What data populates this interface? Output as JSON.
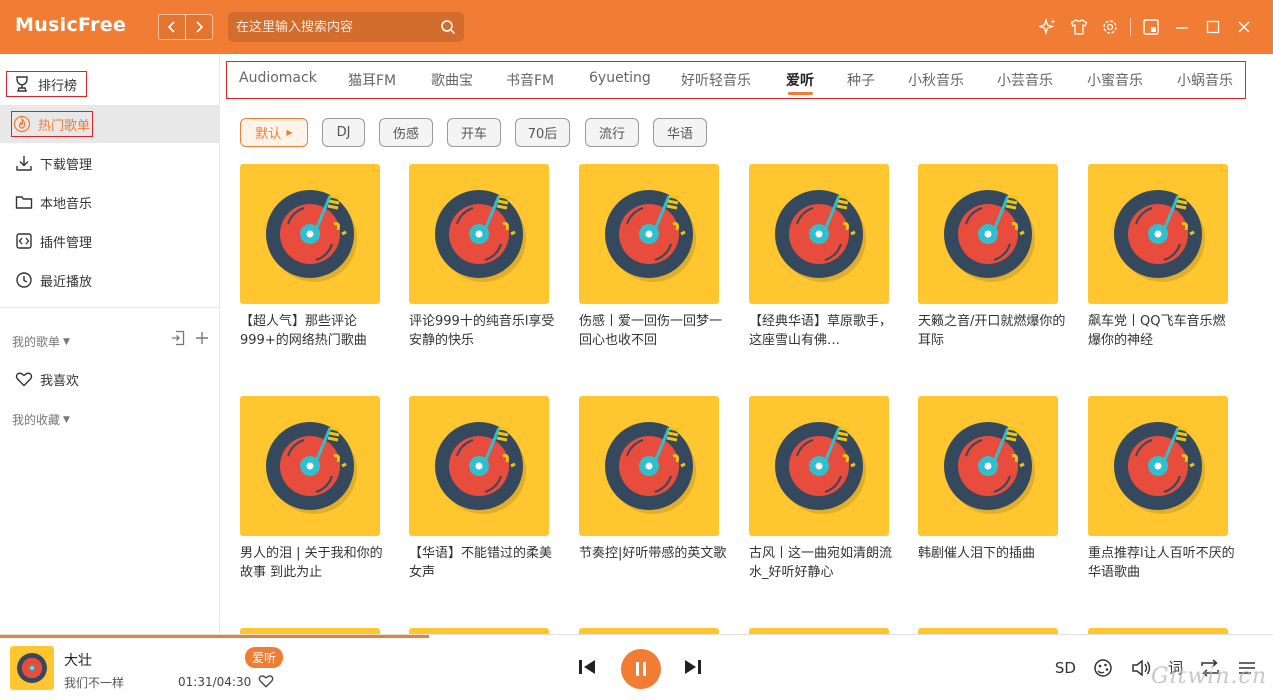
{
  "app": {
    "logo": "MusicFree"
  },
  "search": {
    "placeholder": "在这里输入搜索内容"
  },
  "sidebar": {
    "items": [
      {
        "label": "排行榜",
        "icon": "trophy-icon"
      },
      {
        "label": "热门歌单",
        "icon": "flame-icon",
        "active": true
      },
      {
        "label": "下载管理",
        "icon": "download-icon"
      },
      {
        "label": "本地音乐",
        "icon": "folder-icon"
      },
      {
        "label": "插件管理",
        "icon": "plugin-icon"
      },
      {
        "label": "最近播放",
        "icon": "clock-icon"
      }
    ],
    "my_playlists": "我的歌单",
    "favorites": "我喜欢",
    "my_collections": "我的收藏"
  },
  "tabs": [
    "Audiomack",
    "猫耳FM",
    "歌曲宝",
    "书音FM",
    "6yueting",
    "好听轻音乐",
    "爱听",
    "种子",
    "小秋音乐",
    "小芸音乐",
    "小蜜音乐",
    "小蜗音乐"
  ],
  "active_tab": "爱听",
  "filters": [
    "默认",
    "DJ",
    "伤感",
    "开车",
    "70后",
    "流行",
    "华语"
  ],
  "playlists": [
    "【超人气】那些评论999+的网络热门歌曲",
    "评论999十的纯音乐l享受安静的快乐",
    "伤感丨爱一回伤一回梦一回心也收不回",
    "【经典华语】草原歌手，这座雪山有佛…",
    "天籁之音/开口就燃爆你的耳际",
    "飙车党丨QQ飞车音乐燃爆你的神经",
    "男人的泪 | 关于我和你的故事 到此为止",
    "【华语】不能错过的柔美女声",
    "节奏控|好听带感的英文歌",
    "古风丨这一曲宛如清朗流水_好听好静心",
    "韩剧催人泪下的插曲",
    "重点推荐l让人百听不厌的华语歌曲"
  ],
  "player": {
    "title": "大壮",
    "artist": "我们不一样",
    "source": "爱听",
    "time": "01:31/04:30",
    "progress": 0.337,
    "quality": "SD",
    "lyrics": "词"
  },
  "watermark": "Gitwin.cn",
  "colors": {
    "accent": "#f17d34",
    "cover": "#ffc62f",
    "highlight_box": "#d9232e"
  }
}
